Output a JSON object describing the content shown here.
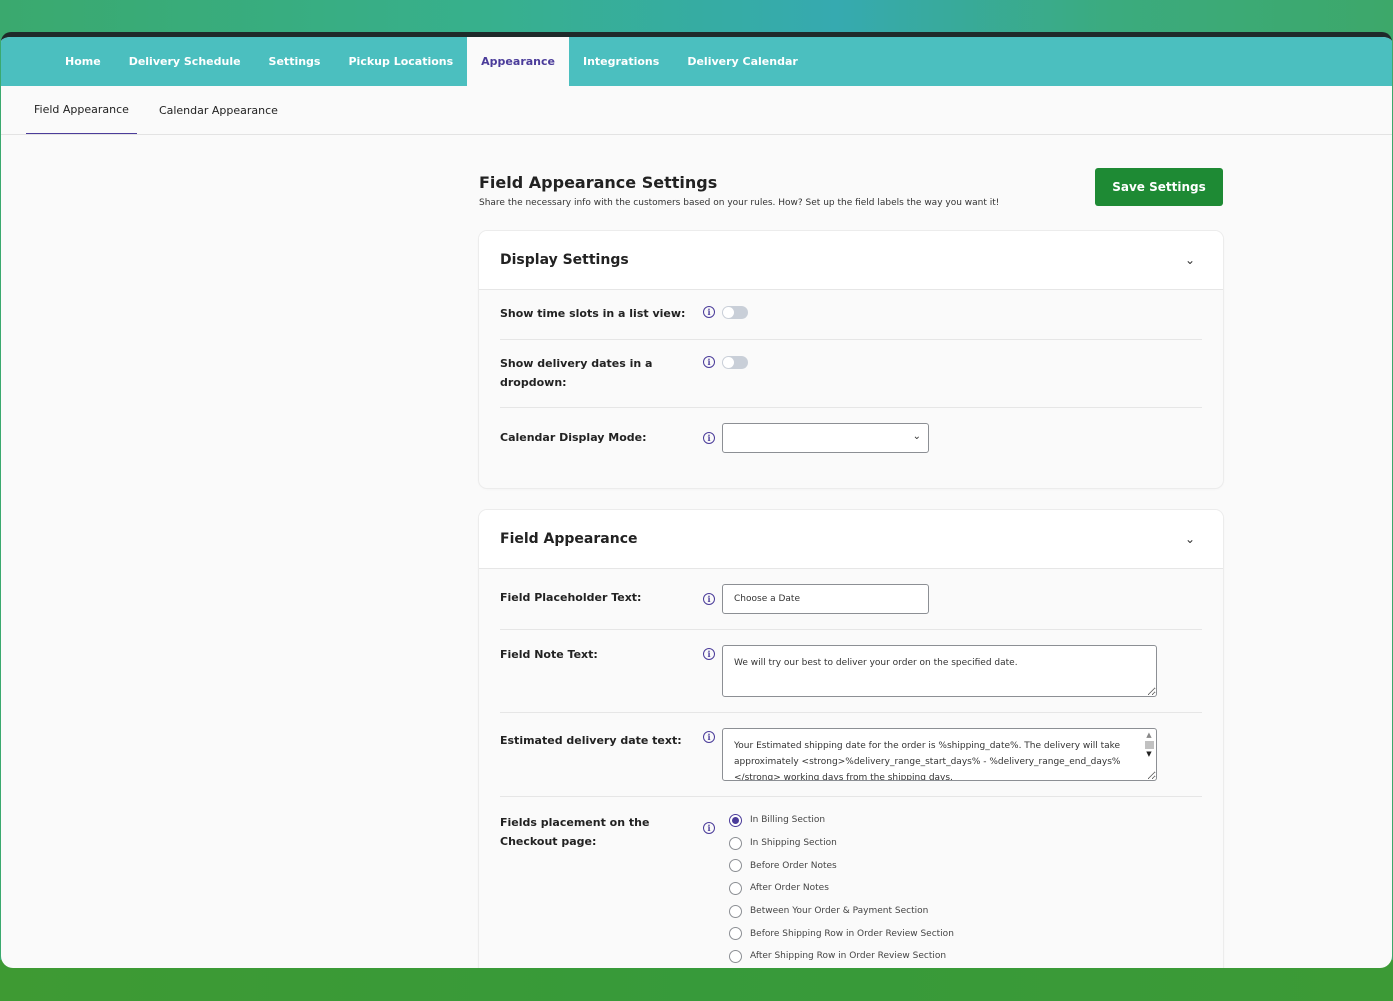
{
  "topnav": {
    "tabs": [
      {
        "label": "Home"
      },
      {
        "label": "Delivery Schedule"
      },
      {
        "label": "Settings"
      },
      {
        "label": "Pickup Locations"
      },
      {
        "label": "Appearance",
        "active": true
      },
      {
        "label": "Integrations"
      },
      {
        "label": "Delivery Calendar"
      }
    ]
  },
  "subnav": {
    "tabs": [
      {
        "label": "Field Appearance",
        "active": true
      },
      {
        "label": "Calendar Appearance"
      }
    ]
  },
  "header": {
    "title": "Field Appearance Settings",
    "subtitle": "Share the necessary info with the customers based on your rules. How? Set up the field labels the way you want it!",
    "save_label": "Save Settings"
  },
  "display_settings": {
    "title": "Display Settings",
    "time_slots_label": "Show time slots in a list view:",
    "time_slots_on": false,
    "delivery_dates_label": "Show delivery dates in a dropdown:",
    "delivery_dates_on": false,
    "calendar_mode_label": "Calendar Display Mode:",
    "calendar_mode_value": ""
  },
  "field_appearance": {
    "title": "Field Appearance",
    "placeholder_label": "Field Placeholder Text:",
    "placeholder_value": "Choose a Date",
    "note_label": "Field Note Text:",
    "note_value": "We will try our best to deliver your order on the specified date.",
    "estimated_label": "Estimated delivery date text:",
    "estimated_value": "Your Estimated shipping date for the order is %shipping_date%. The delivery will take approximately <strong>%delivery_range_start_days% - %delivery_range_end_days%</strong> working days from the shipping days.",
    "placement_label": "Fields placement on the Checkout page:",
    "placement_options": [
      {
        "label": "In Billing Section",
        "checked": true
      },
      {
        "label": "In Shipping Section",
        "checked": false
      },
      {
        "label": "Before Order Notes",
        "checked": false
      },
      {
        "label": "After Order Notes",
        "checked": false
      },
      {
        "label": "Between Your Order & Payment Section",
        "checked": false
      },
      {
        "label": "Before Shipping Row in Order Review Section",
        "checked": false
      },
      {
        "label": "After Shipping Row in Order Review Section",
        "checked": false
      }
    ]
  },
  "colors": {
    "nav_bg": "#4bbfbf",
    "accent": "#4b3c9a",
    "save_button": "#1e8a34"
  }
}
